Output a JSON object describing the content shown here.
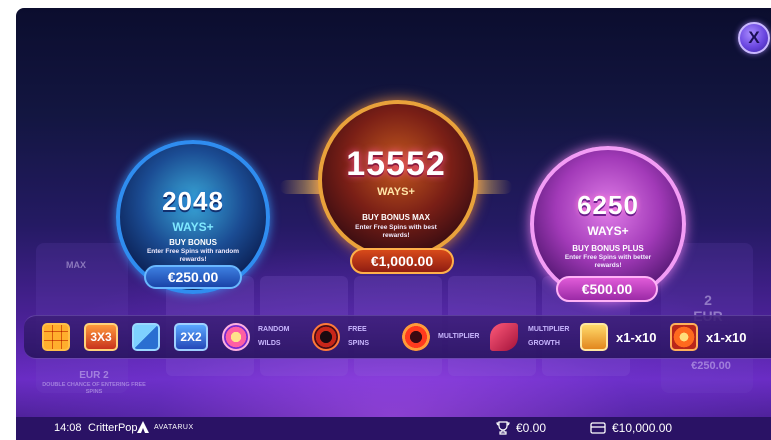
{
  "close": {
    "label": "X"
  },
  "ghost": {
    "left_value": "EUR 2",
    "left_desc": "DOUBLE CHANCE OF ENTERING FREE SPINS",
    "right_value": "2",
    "right_unit": "EUR",
    "right_price": "€250.00",
    "left_tag": "MAX"
  },
  "bonuses": [
    {
      "ways": "2048",
      "ways_label": "WAYS+",
      "title": "BUY BONUS",
      "desc": "Enter Free Spins with random rewards!",
      "price": "€250.00",
      "accent": "#2f8df0"
    },
    {
      "ways": "15552",
      "ways_label": "WAYS+",
      "title": "BUY BONUS MAX",
      "desc": "Enter Free Spins with best rewards!",
      "price": "€1,000.00",
      "accent": "#e9a23b"
    },
    {
      "ways": "6250",
      "ways_label": "WAYS+",
      "title": "BUY BONUS PLUS",
      "desc": "Enter Free Spins with better rewards!",
      "price": "€500.00",
      "accent": "#f39cf5"
    }
  ],
  "features": {
    "size_3x3": "3X3",
    "size_2x2": "2X2",
    "random_wilds_1": "RANDOM",
    "random_wilds_2": "WILDS",
    "free_spins_1": "FREE",
    "free_spins_2": "SPINS",
    "multiplier": "MULTIPLIER",
    "mult_growth_1": "MULTIPLIER",
    "mult_growth_2": "GROWTH",
    "range_1": "x1-x10",
    "range_2": "x1-x10"
  },
  "status_bar": {
    "time": "14:08",
    "game": "CritterPop",
    "brand": "AVATARUX",
    "win": "€0.00",
    "balance": "€10,000.00"
  }
}
